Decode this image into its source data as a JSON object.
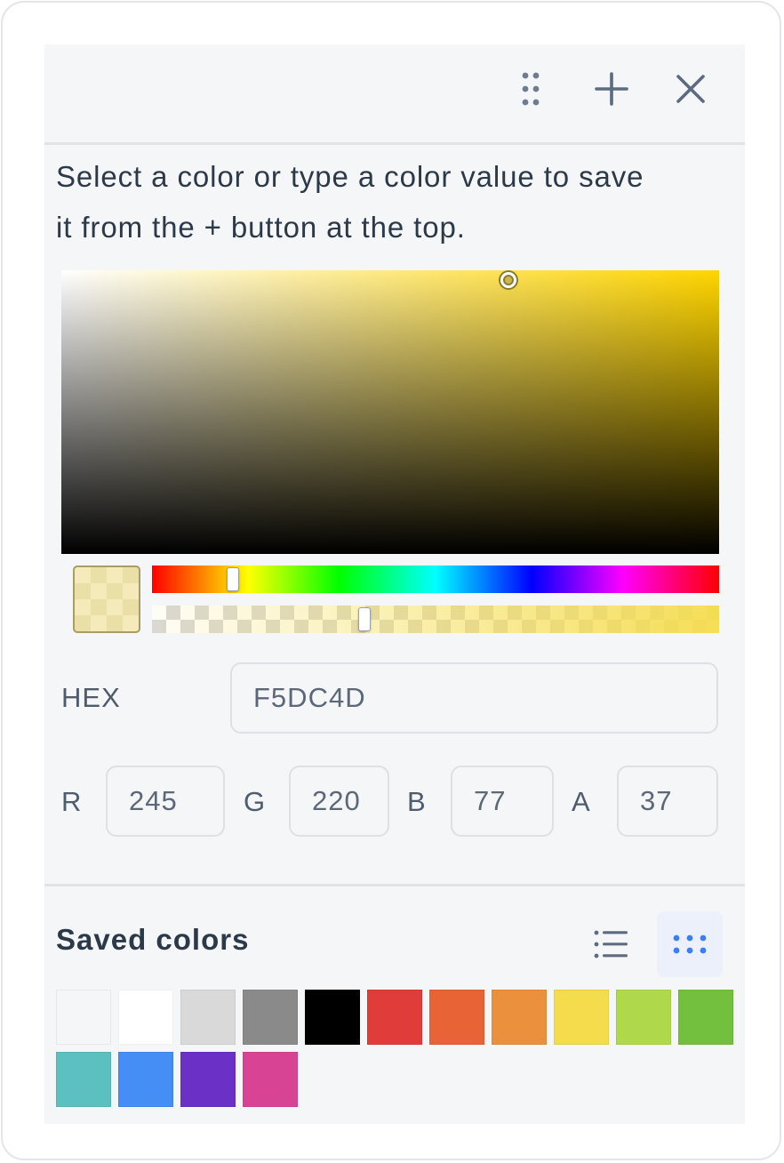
{
  "toolbar": {
    "drag_icon": "drag-handle-icon",
    "add_icon": "plus-icon",
    "close_icon": "close-icon"
  },
  "instructions": {
    "line1": "Select a color or type a color value to save",
    "line2": "it from the + button at the top."
  },
  "picker": {
    "base_hue": "#ffd500",
    "hue_value": "52",
    "alpha_value": "0.37"
  },
  "fields": {
    "hex_label": "HEX",
    "hex_value": "F5DC4D",
    "r_label": "R",
    "r_value": "245",
    "g_label": "G",
    "g_value": "220",
    "b_label": "B",
    "b_value": "77",
    "a_label": "A",
    "a_value": "37"
  },
  "saved": {
    "title": "Saved colors",
    "list_view_icon": "list-view-icon",
    "grid_view_icon": "grid-view-icon",
    "active_view": "grid",
    "swatches": [
      "#f5f6f8",
      "#ffffff",
      "#d9d9d9",
      "#8a8a8a",
      "#000000",
      "#e03c3a",
      "#e86336",
      "#eb913d",
      "#f5dc4d",
      "#afd84a",
      "#72c03e",
      "#5cbfc0",
      "#448ef5",
      "#6b31c7",
      "#d94394"
    ]
  },
  "colors": {
    "text": "#2c3949",
    "icon": "#5c6b80",
    "accent": "#3b7ff0"
  }
}
